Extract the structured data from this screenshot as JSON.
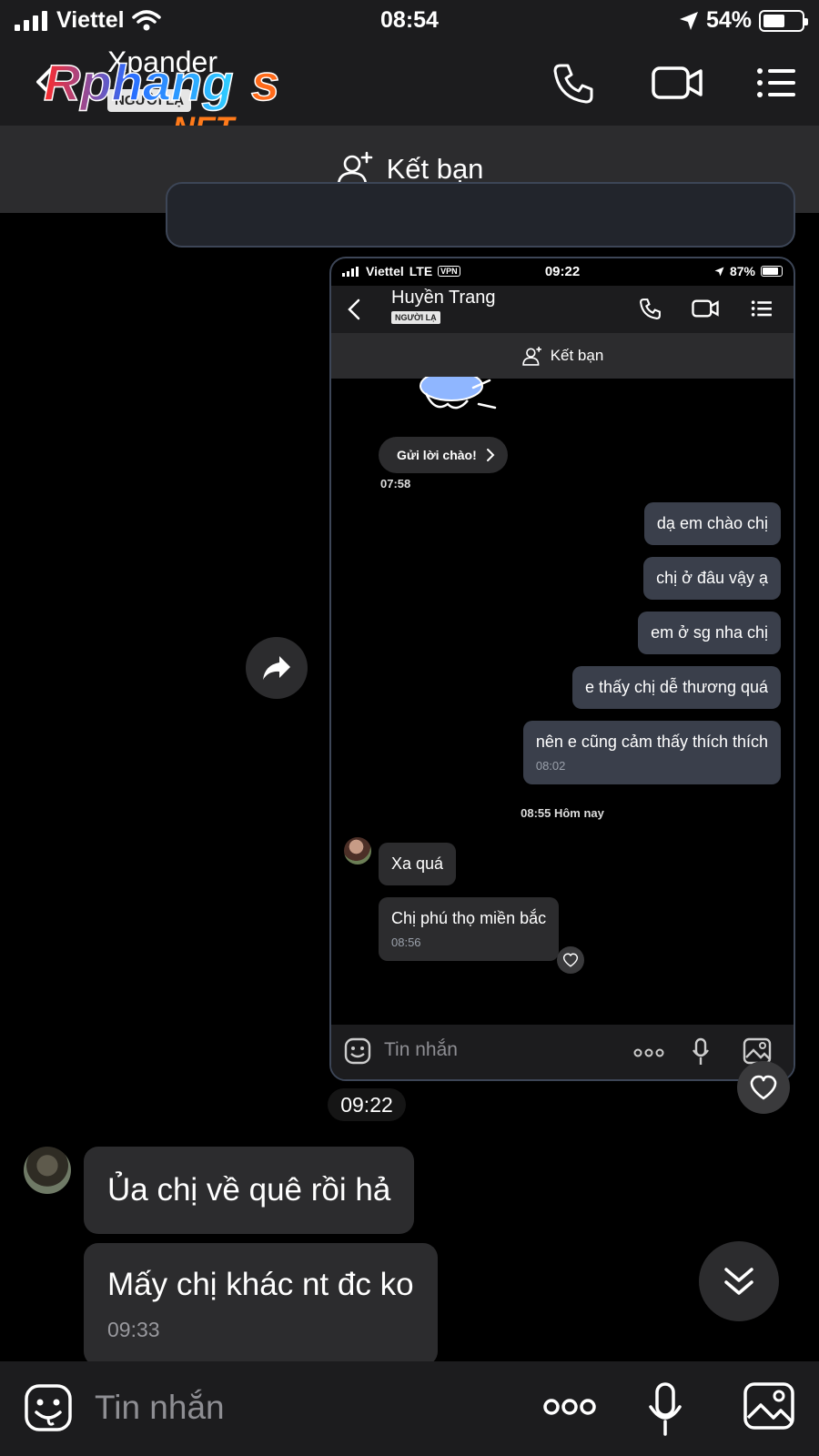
{
  "status_bar": {
    "carrier": "Viettel",
    "time": "08:54",
    "battery": "54%"
  },
  "header": {
    "contact_name": "Xpander",
    "stranger_tag": "NGƯỜI LẠ",
    "watermark_brand": "Rphang",
    "watermark_suffix": "s",
    "watermark_domain": ".NET"
  },
  "friend_bar": {
    "label": "Kết bạn"
  },
  "shared_screenshot": {
    "status": {
      "carrier": "Viettel",
      "network": "LTE",
      "vpn": "VPN",
      "time": "09:22",
      "battery": "87%"
    },
    "contact_name": "Huyền Trang",
    "stranger_tag": "NGƯỜI LẠ",
    "friend_label": "Kết bạn",
    "greet_button": "Gửi lời chào!",
    "greet_time": "07:58",
    "outgoing": [
      {
        "text": "dạ em chào chị"
      },
      {
        "text": "chị ở đâu vậy ạ"
      },
      {
        "text": "em ở sg nha chị"
      },
      {
        "text": "e thấy chị dễ thương quá"
      },
      {
        "text": "nên e cũng cảm thấy thích thích",
        "time": "08:02"
      }
    ],
    "separator": "08:55 Hôm nay",
    "incoming": [
      {
        "text": "Xa quá"
      },
      {
        "text": "Chị phú thọ miền bắc",
        "time": "08:56"
      }
    ],
    "composer_placeholder": "Tin nhắn"
  },
  "shared_time": "09:22",
  "messages": [
    {
      "text": "Ủa chị về quê rồi hả"
    },
    {
      "text": "Mấy chị khác nt đc ko",
      "time": "09:33"
    }
  ],
  "composer": {
    "placeholder": "Tin nhắn"
  },
  "icons": {
    "back": "chevron-left-icon",
    "call": "phone-icon",
    "video": "video-icon",
    "menu": "list-icon",
    "add_friend": "add-user-icon",
    "share": "share-icon",
    "heart": "heart-icon",
    "scroll": "double-chevron-down-icon",
    "sticker": "sticker-icon",
    "more": "more-icon",
    "mic": "mic-icon",
    "image": "image-icon"
  },
  "colors": {
    "background": "#000000",
    "bar": "#1c1c1e",
    "bubble": "#2c2c2e",
    "outgoing_bubble": "#3a3f4b"
  }
}
